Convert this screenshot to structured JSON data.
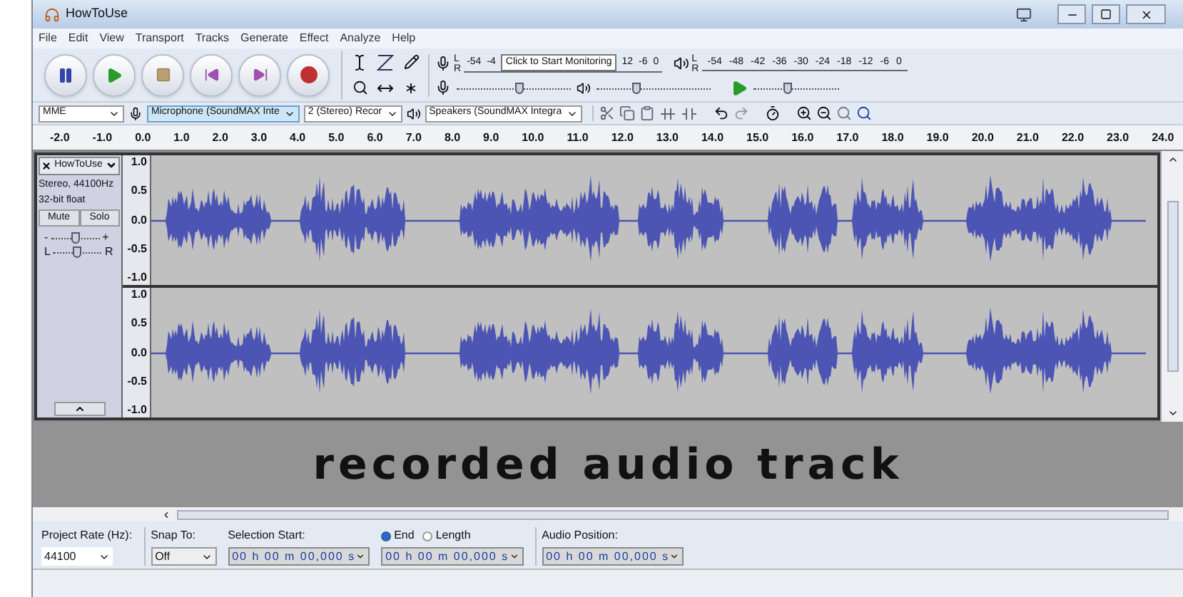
{
  "window": {
    "title": "HowToUse"
  },
  "menu": [
    "File",
    "Edit",
    "View",
    "Transport",
    "Tracks",
    "Generate",
    "Effect",
    "Analyze",
    "Help"
  ],
  "meters": {
    "record": {
      "channels": [
        "L",
        "R"
      ],
      "ticks": [
        "-54",
        "-4"
      ],
      "tooltip": "Click to Start Monitoring",
      "ticks_after": [
        "12",
        "-6",
        "0"
      ]
    },
    "playback": {
      "channels": [
        "L",
        "R"
      ],
      "ticks": [
        "-54",
        "-48",
        "-42",
        "-36",
        "-30",
        "-24",
        "-18",
        "-12",
        "-6",
        "0"
      ]
    }
  },
  "mixer": {
    "record_volume": {
      "level": 0.55
    },
    "playback_volume": {
      "level": 0.35
    }
  },
  "play_at_speed": {
    "level": 0.4
  },
  "devices": {
    "host": "MME",
    "input": "Microphone (SoundMAX Inte",
    "channels": "2 (Stereo) Recor",
    "output": "Speakers (SoundMAX Integra"
  },
  "ruler": {
    "ticks": [
      "-2.0",
      "-1.0",
      "0.0",
      "1.0",
      "2.0",
      "3.0",
      "4.0",
      "5.0",
      "6.0",
      "7.0",
      "8.0",
      "9.0",
      "10.0",
      "11.0",
      "12.0",
      "13.0",
      "14.0",
      "15.0",
      "16.0",
      "17.0",
      "18.0",
      "19.0",
      "20.0",
      "21.0",
      "22.0",
      "23.0",
      "24.0"
    ]
  },
  "track": {
    "name": "HowToUse",
    "info": [
      "Stereo, 44100Hz",
      "32-bit float"
    ],
    "buttons": [
      "Mute",
      "Solo"
    ],
    "gain": {
      "min": "-",
      "max": "+",
      "level": 0.5
    },
    "pan": {
      "left": "L",
      "right": "R",
      "level": 0.5
    },
    "channels": [
      {
        "scale": [
          "1.0",
          "0.5",
          "0.0",
          "-0.5",
          "-1.0"
        ]
      },
      {
        "scale": [
          "1.0",
          "0.5",
          "0.0",
          "-0.5",
          "-1.0"
        ]
      }
    ]
  },
  "caption": "recorded audio track",
  "selection_bar": {
    "project_rate": {
      "label": "Project Rate (Hz):",
      "value": "44100"
    },
    "snap_to": {
      "label": "Snap To:",
      "value": "Off"
    },
    "selection_start": {
      "label": "Selection Start:",
      "value": "00 h 00 m 00,000 s"
    },
    "radios": [
      {
        "label": "End",
        "selected": true
      },
      {
        "label": "Length",
        "selected": false
      }
    ],
    "end_value": "00 h 00 m 00,000 s",
    "audio_position": {
      "label": "Audio Position:",
      "value": "00 h 00 m 00,000 s"
    }
  }
}
